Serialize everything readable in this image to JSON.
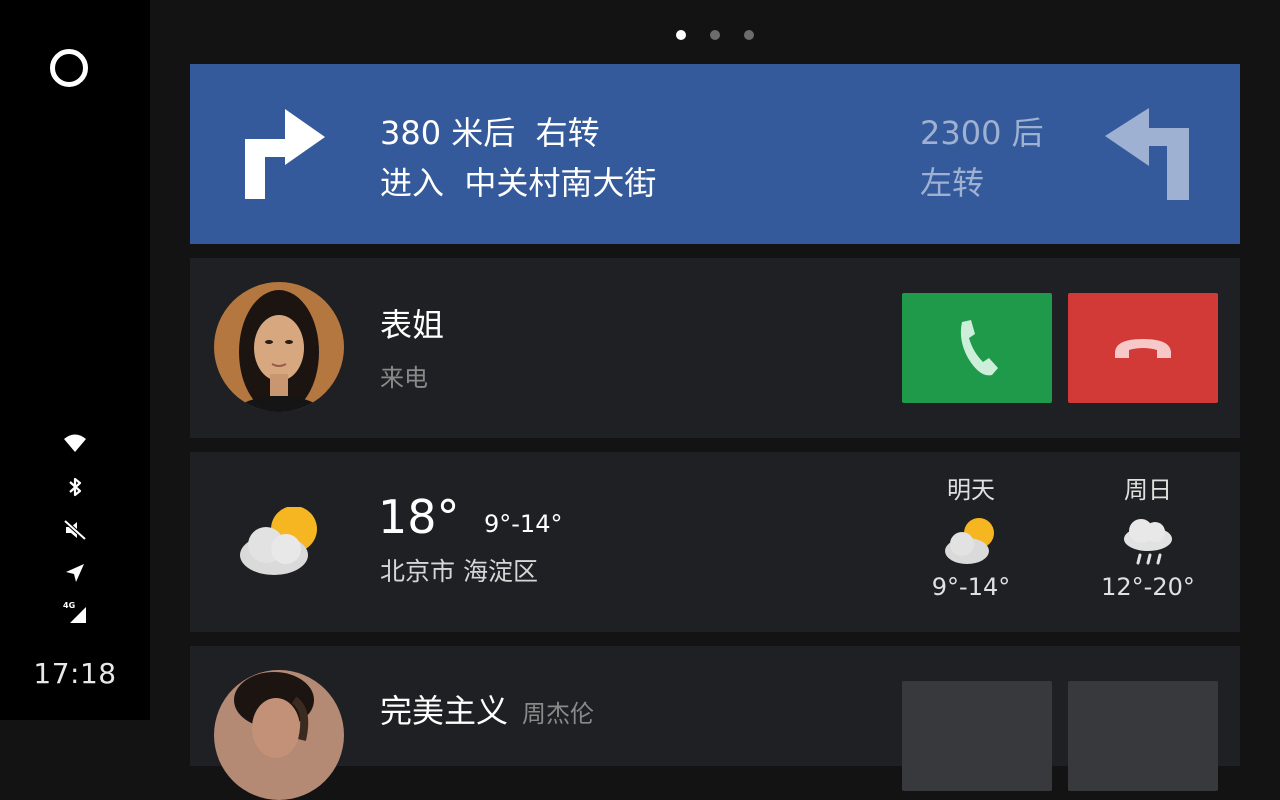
{
  "status_bar": {
    "icons": [
      "wifi-icon",
      "bluetooth-icon",
      "mute-icon",
      "location-arrow-icon",
      "signal-4g-icon"
    ],
    "network_label": "4G",
    "time": "17:18"
  },
  "pager": {
    "pages": 3,
    "active": 0
  },
  "navigation": {
    "distance": "380 米后",
    "turn": "右转",
    "enter": "进入",
    "street": "中关村南大街",
    "next_distance": "2300 后",
    "next_turn": "左转",
    "colors": {
      "background": "#355a9b"
    }
  },
  "call": {
    "caller": "表姐",
    "status": "来电",
    "accept_icon": "phone-answer-icon",
    "reject_icon": "phone-hangup-icon",
    "colors": {
      "accept": "#1f9a4a",
      "reject": "#d13a37"
    }
  },
  "weather": {
    "temperature": "18°",
    "range": "9°-14°",
    "location": "北京市 海淀区",
    "icon": "partly-cloudy-icon",
    "forecast": [
      {
        "day": "明天",
        "icon": "partly-cloudy-icon",
        "range": "9°-14°"
      },
      {
        "day": "周日",
        "icon": "rain-cloud-icon",
        "range": "12°-20°"
      }
    ]
  },
  "music": {
    "song": "完美主义",
    "artist": "周杰伦"
  }
}
